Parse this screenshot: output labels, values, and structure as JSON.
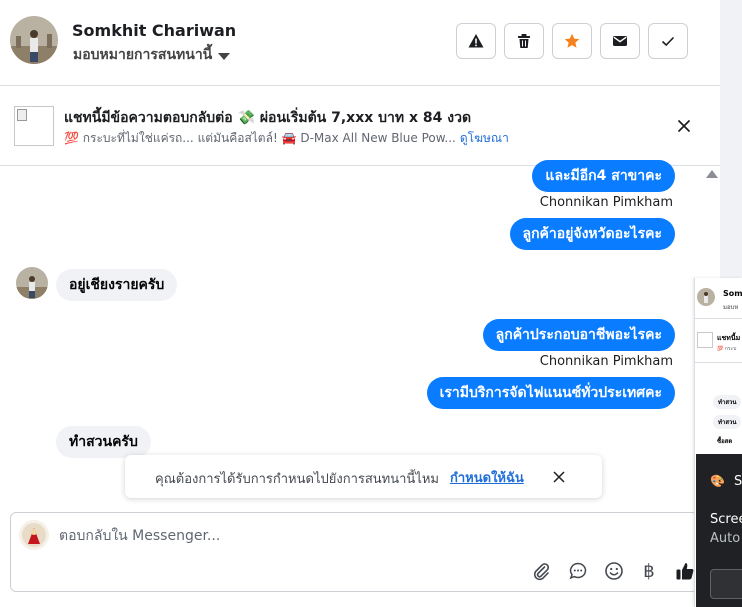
{
  "header": {
    "name": "Somkhit Chariwan",
    "assign_label": "มอบหมายการสนทนานี้"
  },
  "ad": {
    "title": "แชทนี้มีข้อความตอบกลับต่อ 💸 ผ่อนเริ่มต้น 7,xxx บาท x 84 งวด",
    "subtitle": "💯 กระบะที่ไม่ใช่แค่รถ... แต่มันคือสไตล์! 🚘 D-Max All New Blue Pow...",
    "link": "ดูโฆษณา"
  },
  "messages": {
    "m1": "และมีอีก4 สาขาคะ",
    "sender1": "Chonnikan Pimkham",
    "m2": "ลูกค้าอยู่จังหวัดอะไรคะ",
    "m3": "อยู่เชียงรายครับ",
    "m4": "ลูกค้าประกอบอาชีพอะไรคะ",
    "sender2": "Chonnikan Pimkham",
    "m5": "เรามีบริการจัดไฟแนนซ์ทั่วประเทศคะ",
    "m6": "ทำสวนครับ"
  },
  "toast": {
    "text": "คุณต้องการได้รับการกำหนดไปยังการสนทนานี้ไหม",
    "link": "กำหนดให้ฉัน"
  },
  "composer": {
    "placeholder": "ตอบกลับใน Messenger...",
    "currency_symbol": "฿"
  },
  "side_panel": {
    "name": "Somk",
    "assign": "มอบห",
    "ad_title": "แชทนี้ม",
    "ad_sub": "💯 กระบ",
    "msg1": "ทำสวน",
    "msg2": "ทำสวน",
    "msg3": "ซื้อสด"
  },
  "notification": {
    "icon": "🎨",
    "letter": "S",
    "line1": "Scree",
    "line2": "Auto"
  },
  "colors": {
    "accent": "#0a7cff",
    "link": "#216fdb",
    "star": "#f5821f"
  }
}
